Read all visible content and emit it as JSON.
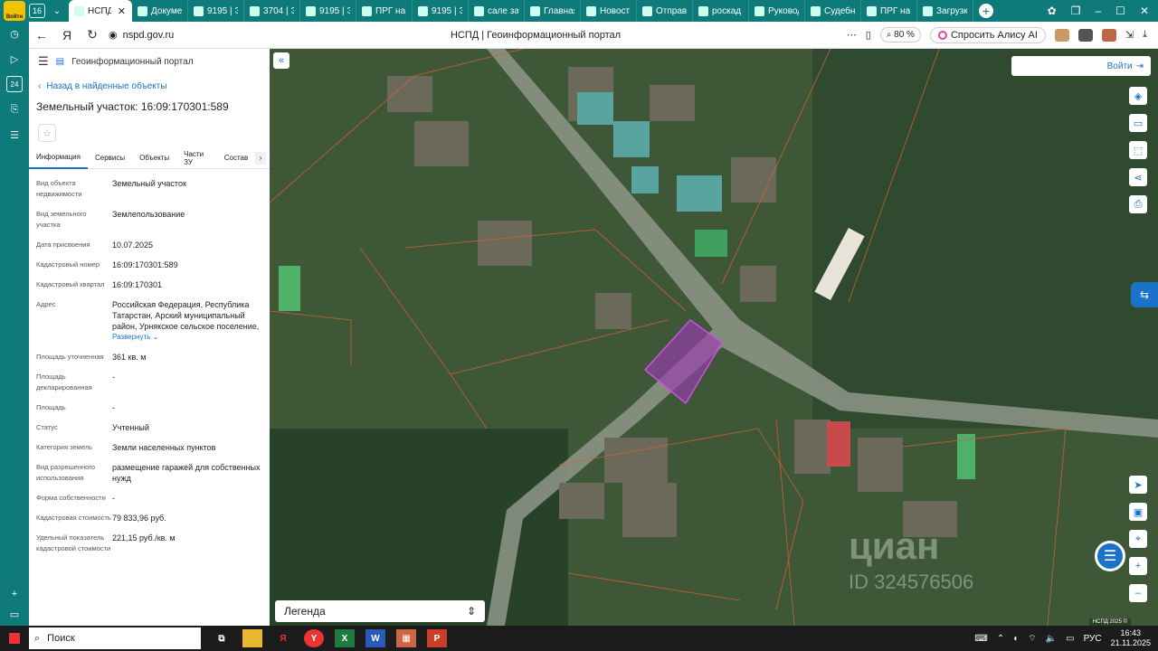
{
  "browser": {
    "login_badge": "Войти",
    "tab_count": "16",
    "tabs": [
      {
        "label": "НСПД",
        "active": true
      },
      {
        "label": "Докуме"
      },
      {
        "label": "9195 | Э"
      },
      {
        "label": "3704 | Э"
      },
      {
        "label": "9195 | Э"
      },
      {
        "label": "ПРГ на"
      },
      {
        "label": "9195 | Э"
      },
      {
        "label": "сале за"
      },
      {
        "label": "Главная"
      },
      {
        "label": "Новост"
      },
      {
        "label": "Отправ"
      },
      {
        "label": "роскад"
      },
      {
        "label": "Руковод"
      },
      {
        "label": "Судебн"
      },
      {
        "label": "ПРГ на"
      },
      {
        "label": "Загрузк"
      }
    ],
    "url": "nspd.gov.ru",
    "page_title": "НСПД | Геоинформационный портал",
    "zoom": "80 %",
    "alice": "Спросить Алису AI",
    "sidebar_badge": "24"
  },
  "panel": {
    "portal": "Геоинформационный портал",
    "back": "Назад в найденные объекты",
    "title": "Земельный участок: 16:09:170301:589",
    "tabs": [
      "Информация",
      "Сервисы",
      "Объекты",
      "Части ЗУ",
      "Состав"
    ],
    "rows": [
      {
        "k": "Вид объекта недвижимости",
        "v": "Земельный участок"
      },
      {
        "k": "Вид земельного участка",
        "v": "Землепользование"
      },
      {
        "k": "Дата присвоения",
        "v": "10.07.2025"
      },
      {
        "k": "Кадастровый номер",
        "v": "16:09:170301:589"
      },
      {
        "k": "Кадастровый квартал",
        "v": "16:09:170301"
      },
      {
        "k": "Адрес",
        "v": "Российская Федерация, Республика Татарстан, Арский муниципальный район, Урнякское сельское поселение,"
      },
      {
        "k": "Площадь уточненная",
        "v": "361 кв. м"
      },
      {
        "k": "Площадь декларированная",
        "v": "-"
      },
      {
        "k": "Площадь",
        "v": "-"
      },
      {
        "k": "Статус",
        "v": "Учтенный"
      },
      {
        "k": "Категория земель",
        "v": "Земли населенных пунктов"
      },
      {
        "k": "Вид разрешенного использования",
        "v": "размещение гаражей для собственных нужд"
      },
      {
        "k": "Форма собственности",
        "v": "-"
      },
      {
        "k": "Кадастровая стоимость",
        "v": "79 833,96 руб."
      },
      {
        "k": "Удельный показатель кадастровой стоимости",
        "v": "221,15 руб./кв. м"
      }
    ],
    "expand": "Развернуть"
  },
  "map": {
    "login": "Войти",
    "legend": "Легенда",
    "watermark_main": "циан",
    "watermark_id": "ID 324576506",
    "scale": "НСПД 2025 ©"
  },
  "taskbar": {
    "search": "Поиск",
    "lang": "РУС",
    "time": "16:43",
    "date": "21.11.2025"
  },
  "colors": {
    "browser_accent": "#0e7a7a",
    "link": "#1a73c8",
    "parcel": "#c03cc8"
  }
}
